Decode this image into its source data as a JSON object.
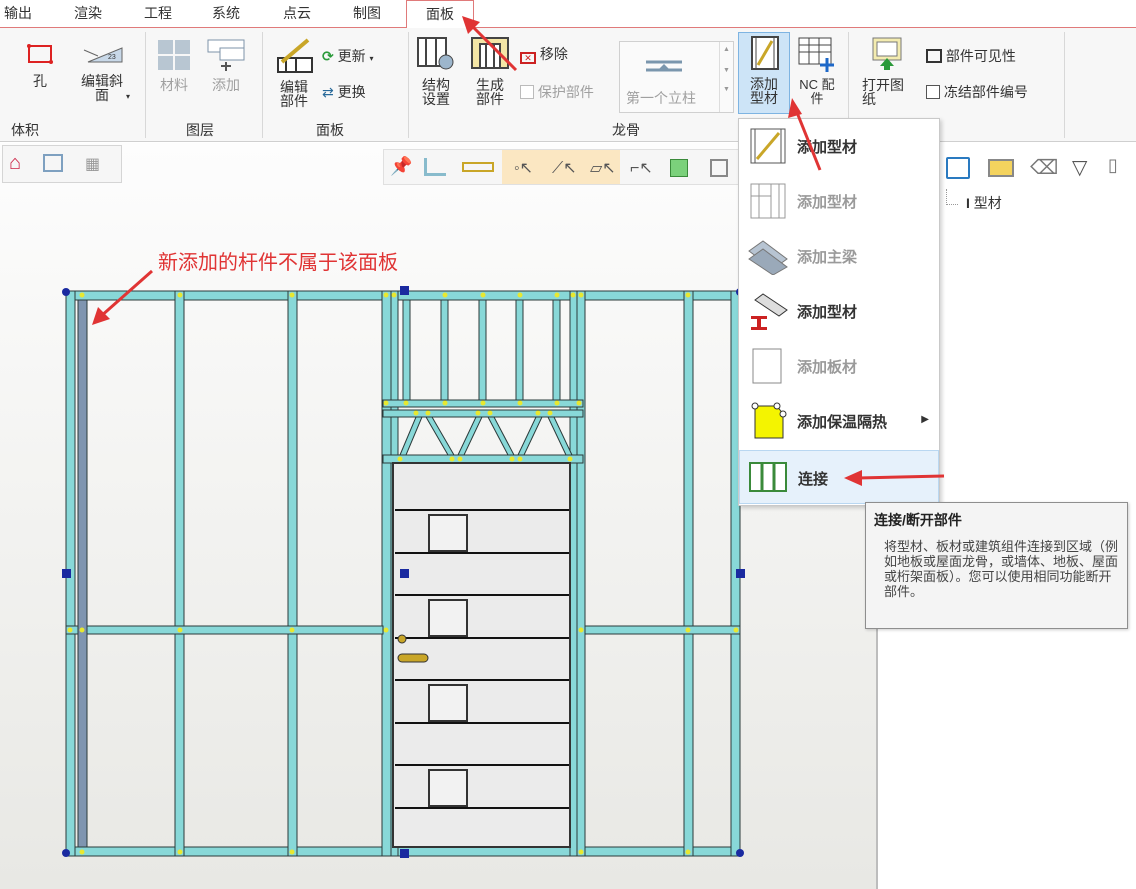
{
  "tabs": [
    {
      "label": "输出"
    },
    {
      "label": "渲染"
    },
    {
      "label": "工程"
    },
    {
      "label": "系统"
    },
    {
      "label": "点云"
    },
    {
      "label": "制图"
    },
    {
      "label": "面板",
      "active": true
    }
  ],
  "ribbon": {
    "groups": {
      "volume": "体积",
      "layers": "图层",
      "panel": "面板",
      "framing": "龙骨"
    },
    "hole": "孔",
    "edit_slope": "编辑斜\n面",
    "material": "材料",
    "add_layer": "添加",
    "edit_part": "编辑\n部件",
    "update": "更新",
    "replace": "更换",
    "struct_settings": "结构\n设置",
    "generate_part": "生成\n部件",
    "remove": "移除",
    "protect_part": "保护部件",
    "first_column": "第一个立柱",
    "add_profile": "添加\n型材",
    "nc_parts": "NC 配\n件",
    "open_drawing": "打开图\n纸",
    "part_visibility": "部件可见性",
    "freeze_part_number": "冻结部件编号"
  },
  "dropdown": {
    "items": [
      {
        "label": "添加型材",
        "enabled": true,
        "icon": "profile-icon"
      },
      {
        "label": "添加型材",
        "enabled": false,
        "icon": "profile-grid-icon"
      },
      {
        "label": "添加主梁",
        "enabled": false,
        "icon": "main-beam-icon"
      },
      {
        "label": "添加型材",
        "enabled": true,
        "icon": "i-beam-icon"
      },
      {
        "label": "添加板材",
        "enabled": false,
        "icon": "board-icon"
      },
      {
        "label": "添加保温隔热",
        "enabled": true,
        "icon": "insulation-icon",
        "submenu": true
      },
      {
        "label": "连接",
        "enabled": true,
        "icon": "connect-icon",
        "hover": true
      }
    ]
  },
  "tooltip": {
    "title": "连接/断开部件",
    "body": "将型材、板材或建筑组件连接到区域（例如地板或屋面龙骨，或墙体、地板、屋面或桁架面板）。您可以使用相同功能断开部件。"
  },
  "tree": {
    "item_label": "型材"
  },
  "annotation": "新添加的杆件不属于该面板",
  "colors": {
    "stud": "#88d8d8",
    "stud_edge": "#2b3a3a",
    "node": "#e8e830",
    "arrow": "#e03434",
    "accent_tab_border": "#e07a7a"
  }
}
